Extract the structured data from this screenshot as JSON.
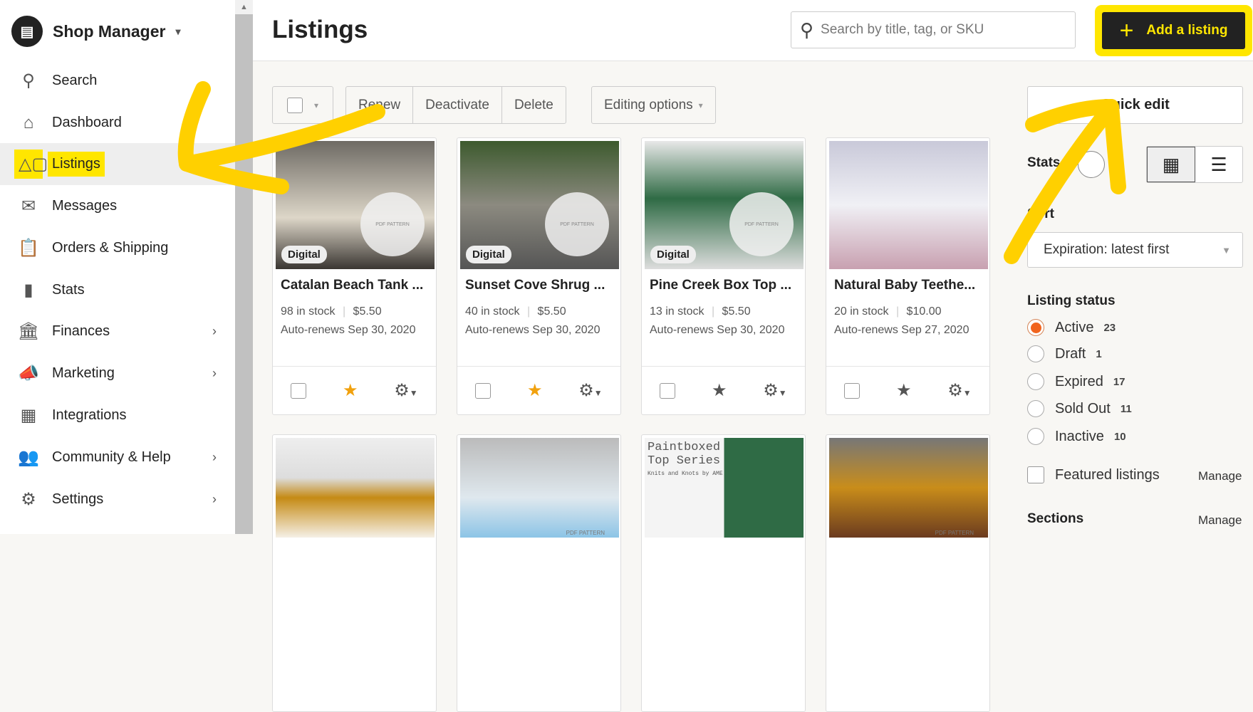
{
  "sidebar": {
    "brand": "Shop Manager",
    "brand_caret": "▾",
    "items": [
      {
        "label": "Search",
        "icon": "⚲"
      },
      {
        "label": "Dashboard",
        "icon": "⌂"
      },
      {
        "label": "Listings",
        "icon": "△▢",
        "active": true
      },
      {
        "label": "Messages",
        "icon": "✉"
      },
      {
        "label": "Orders & Shipping",
        "icon": "📋"
      },
      {
        "label": "Stats",
        "icon": "▮"
      },
      {
        "label": "Finances",
        "icon": "🏛",
        "chevron": "›"
      },
      {
        "label": "Marketing",
        "icon": "📣",
        "chevron": "›"
      },
      {
        "label": "Integrations",
        "icon": "▦"
      },
      {
        "label": "Community & Help",
        "icon": "👥",
        "chevron": "›"
      },
      {
        "label": "Settings",
        "icon": "⚙",
        "chevron": "›"
      }
    ]
  },
  "header": {
    "title": "Listings",
    "search_placeholder": "Search by title, tag, or SKU",
    "add_label": "Add a listing",
    "add_icon": "+"
  },
  "toolbar": {
    "renew": "Renew",
    "deactivate": "Deactivate",
    "delete": "Delete",
    "editing": "Editing options",
    "caret": "▾"
  },
  "cards": [
    {
      "title": "Catalan Beach Tank ...",
      "stock": "98 in stock",
      "price": "$5.50",
      "renews": "Auto-renews Sep 30, 2020",
      "badge": "Digital",
      "featured": true,
      "burst": "PDF PATTERN"
    },
    {
      "title": "Sunset Cove Shrug ...",
      "stock": "40 in stock",
      "price": "$5.50",
      "renews": "Auto-renews Sep 30, 2020",
      "badge": "Digital",
      "featured": true,
      "burst": "PDF PATTERN"
    },
    {
      "title": "Pine Creek Box Top ...",
      "stock": "13 in stock",
      "price": "$5.50",
      "renews": "Auto-renews Sep 30, 2020",
      "badge": "Digital",
      "featured": false,
      "burst": "PDF PATTERN"
    },
    {
      "title": "Natural Baby Teethe...",
      "stock": "20 in stock",
      "price": "$10.00",
      "renews": "Auto-renews Sep 27, 2020",
      "featured": false
    }
  ],
  "row2": [
    {
      "caption": ""
    },
    {
      "caption": "PDF PATTERN"
    },
    {
      "caption": "Paintboxed Top Series",
      "sub": "Knits and Knots by AME"
    },
    {
      "caption": "PDF PATTERN"
    }
  ],
  "panel": {
    "quick_edit": "Quick edit",
    "stats_label": "Stats",
    "sort_label": "Sort",
    "sort_value": "Expiration: latest first",
    "status_title": "Listing status",
    "statuses": [
      {
        "label": "Active",
        "count": "23",
        "selected": true
      },
      {
        "label": "Draft",
        "count": "1"
      },
      {
        "label": "Expired",
        "count": "17"
      },
      {
        "label": "Sold Out",
        "count": "11"
      },
      {
        "label": "Inactive",
        "count": "10"
      }
    ],
    "featured": "Featured listings",
    "manage": "Manage",
    "sections": "Sections"
  },
  "colors": {
    "highlight": "#ffe600",
    "accent": "#f1641e",
    "star": "#f1a10e",
    "button": "#222222"
  }
}
